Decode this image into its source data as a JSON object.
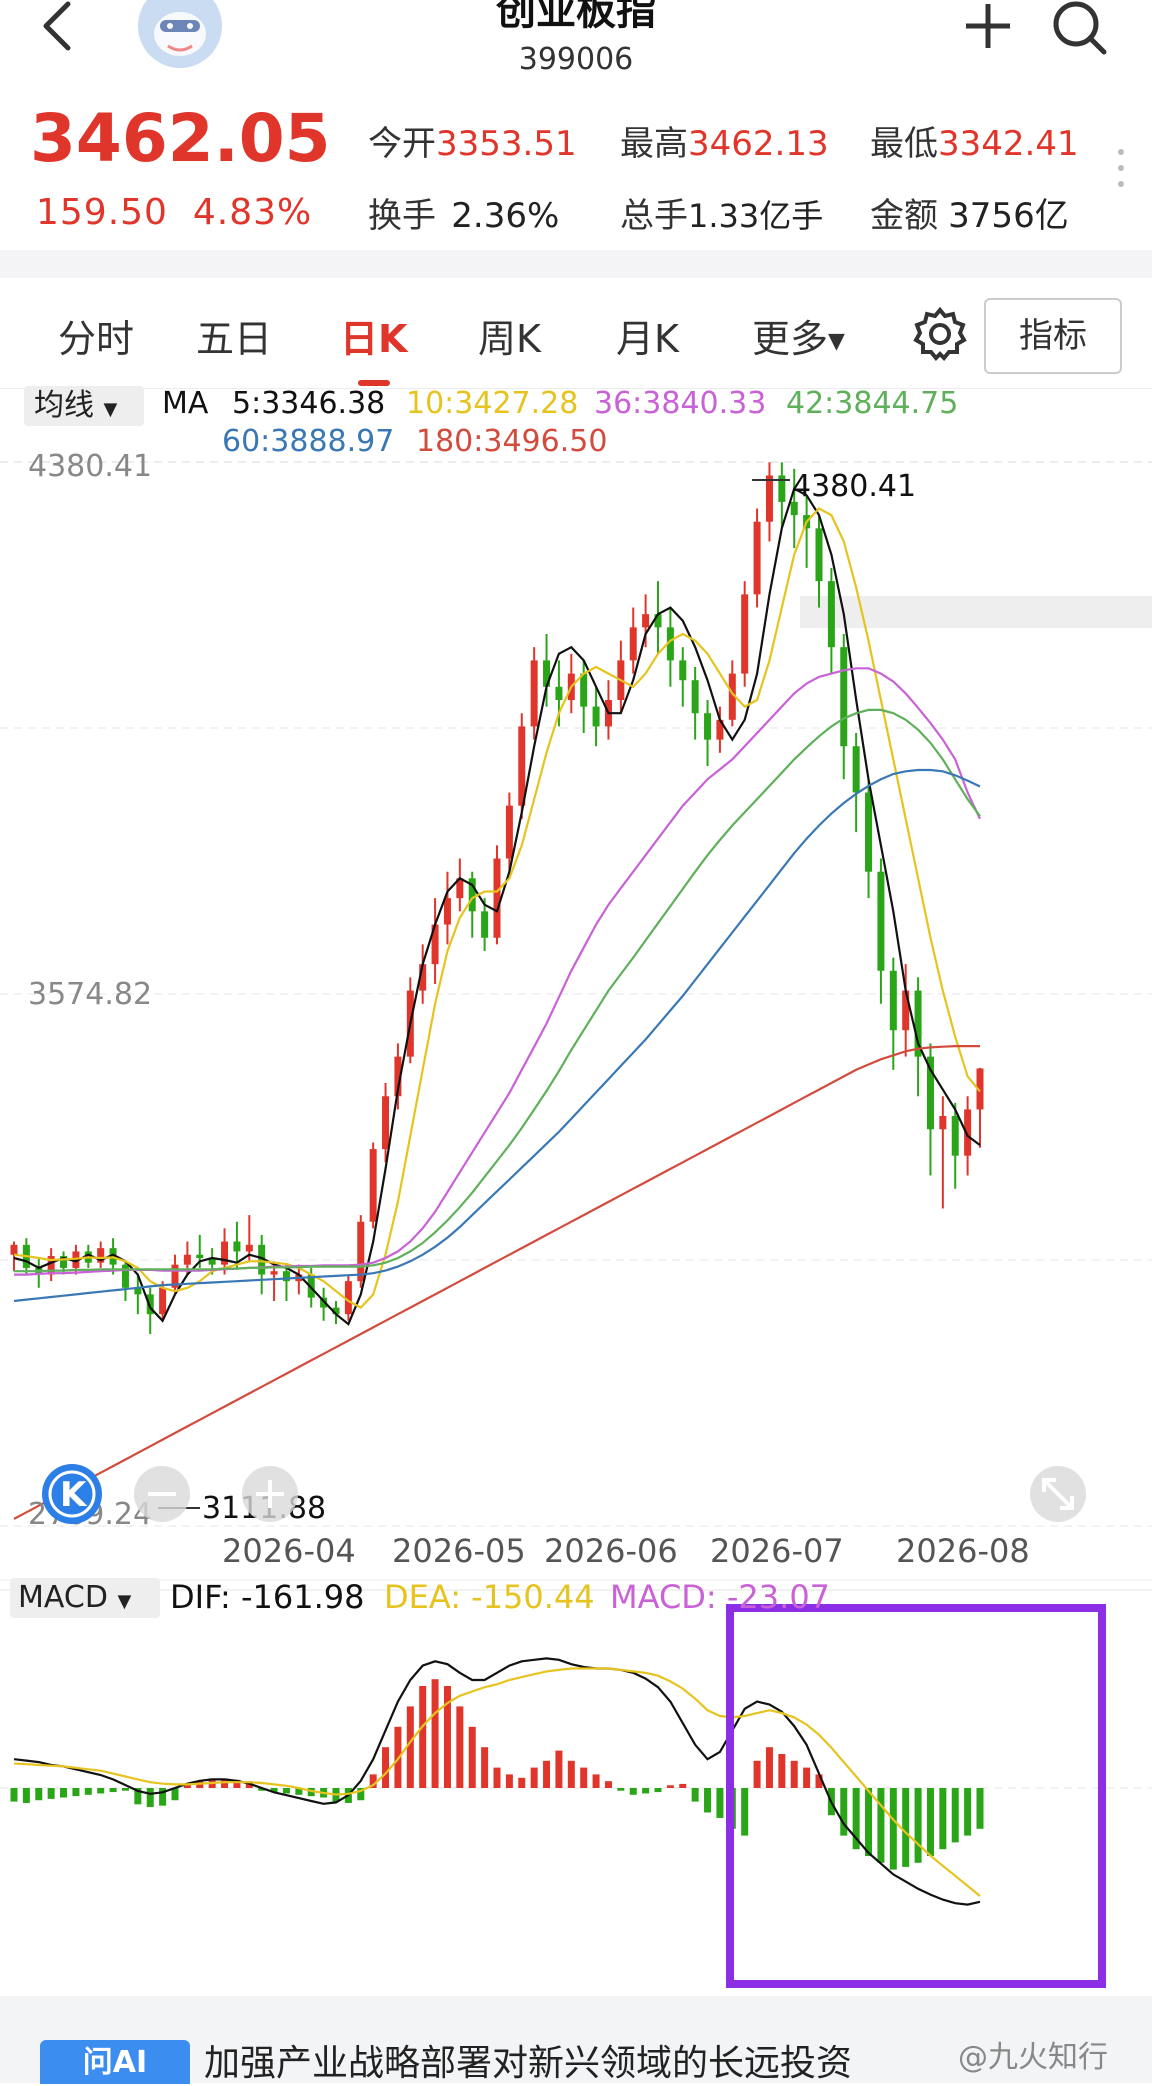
{
  "header": {
    "title": "创业板指",
    "code": "399006",
    "back_icon": "back-arrow-icon",
    "add_icon": "plus-icon",
    "search_icon": "search-icon"
  },
  "quote": {
    "price": "3462.05",
    "change": "159.50",
    "change_pct": "4.83%",
    "open_label": "今开",
    "open": "3353.51",
    "high_label": "最高",
    "high": "3462.13",
    "low_label": "最低",
    "low": "3342.41",
    "turnover_label": "换手",
    "turnover": "2.36%",
    "volume_label": "总手",
    "volume": "1.33亿手",
    "amount_label": "金额",
    "amount": "3756亿"
  },
  "tabs": [
    {
      "label": "分时"
    },
    {
      "label": "五日"
    },
    {
      "label": "日K",
      "active": true
    },
    {
      "label": "周K"
    },
    {
      "label": "月K"
    },
    {
      "label": "更多"
    }
  ],
  "indicator_button": "指标",
  "ma_legend": {
    "selector": "均线",
    "prefix": "MA",
    "items": [
      {
        "text": "5:3346.38",
        "color": "#111111"
      },
      {
        "text": "10:3427.28",
        "color": "#e6c31e"
      },
      {
        "text": "36:3840.33",
        "color": "#c862d6"
      },
      {
        "text": "42:3844.75",
        "color": "#5fb05a"
      },
      {
        "text": "60:3888.97",
        "color": "#3a78b5"
      },
      {
        "text": "180:3496.50",
        "color": "#d24b3c"
      }
    ]
  },
  "chart_labels": {
    "high_price": "4380.41",
    "mid_price": "3574.82",
    "low_price": "2769.24",
    "max_marker": "4380.41",
    "min_marker": "3111.88"
  },
  "chart_data": {
    "type": "candlestick",
    "ylim": [
      2769.24,
      4380.41
    ],
    "x_ticks": [
      "2026-04",
      "2026-05",
      "2026-06",
      "2026-07",
      "2026-08"
    ],
    "max_close_marker": 4380.41,
    "min_marker": 3111.88,
    "ma": {
      "MA5": [
        3175,
        3170,
        3160,
        3168,
        3175,
        3170,
        3180,
        3172,
        3180,
        3170,
        3150,
        3100,
        3080,
        3120,
        3150,
        3170,
        3175,
        3172,
        3168,
        3180,
        3175,
        3165,
        3160,
        3150,
        3130,
        3110,
        3090,
        3075,
        3120,
        3200,
        3310,
        3430,
        3530,
        3620,
        3680,
        3730,
        3750,
        3740,
        3710,
        3700,
        3760,
        3850,
        3950,
        4040,
        4090,
        4100,
        4080,
        4040,
        4000,
        4000,
        4050,
        4120,
        4150,
        4160,
        4140,
        4100,
        4050,
        3990,
        3960,
        3990,
        4060,
        4180,
        4280,
        4340,
        4330,
        4300,
        4240,
        4150,
        4020,
        3900,
        3800,
        3700,
        3580,
        3500,
        3460,
        3430,
        3400,
        3360,
        3346
      ],
      "MA10": [
        3180,
        3178,
        3175,
        3172,
        3173,
        3174,
        3176,
        3175,
        3176,
        3170,
        3160,
        3140,
        3130,
        3125,
        3130,
        3140,
        3155,
        3160,
        3165,
        3170,
        3170,
        3168,
        3166,
        3160,
        3150,
        3140,
        3125,
        3110,
        3100,
        3120,
        3180,
        3260,
        3360,
        3460,
        3560,
        3640,
        3690,
        3720,
        3730,
        3730,
        3750,
        3800,
        3870,
        3940,
        4000,
        4040,
        4060,
        4070,
        4060,
        4050,
        4040,
        4060,
        4090,
        4110,
        4120,
        4110,
        4090,
        4060,
        4030,
        4010,
        4020,
        4080,
        4160,
        4240,
        4290,
        4310,
        4300,
        4260,
        4190,
        4110,
        4020,
        3930,
        3840,
        3750,
        3660,
        3580,
        3510,
        3450,
        3427
      ],
      "MA36": [
        3150,
        3150,
        3151,
        3152,
        3152,
        3153,
        3154,
        3155,
        3156,
        3157,
        3157,
        3157,
        3156,
        3156,
        3156,
        3156,
        3157,
        3158,
        3159,
        3160,
        3161,
        3162,
        3162,
        3163,
        3163,
        3164,
        3164,
        3164,
        3165,
        3168,
        3175,
        3185,
        3200,
        3220,
        3245,
        3275,
        3305,
        3335,
        3365,
        3395,
        3425,
        3460,
        3495,
        3530,
        3570,
        3610,
        3645,
        3680,
        3710,
        3735,
        3760,
        3785,
        3810,
        3835,
        3860,
        3880,
        3900,
        3915,
        3930,
        3950,
        3970,
        3990,
        4010,
        4030,
        4045,
        4055,
        4060,
        4065,
        4068,
        4068,
        4060,
        4048,
        4030,
        4008,
        3985,
        3960,
        3930,
        3880,
        3840
      ],
      "MA42": [
        3155,
        3155,
        3155,
        3156,
        3156,
        3157,
        3157,
        3158,
        3158,
        3158,
        3158,
        3158,
        3158,
        3158,
        3158,
        3158,
        3158,
        3159,
        3159,
        3160,
        3160,
        3161,
        3161,
        3161,
        3162,
        3162,
        3162,
        3162,
        3162,
        3164,
        3168,
        3175,
        3185,
        3198,
        3214,
        3232,
        3252,
        3274,
        3298,
        3322,
        3346,
        3372,
        3400,
        3428,
        3458,
        3490,
        3520,
        3550,
        3580,
        3605,
        3630,
        3656,
        3682,
        3708,
        3734,
        3760,
        3785,
        3808,
        3830,
        3850,
        3870,
        3890,
        3910,
        3930,
        3948,
        3965,
        3980,
        3992,
        4000,
        4005,
        4005,
        4000,
        3990,
        3975,
        3955,
        3930,
        3900,
        3870,
        3844
      ],
      "MA60": [
        3110,
        3112,
        3114,
        3116,
        3118,
        3120,
        3122,
        3124,
        3126,
        3128,
        3130,
        3132,
        3134,
        3135,
        3136,
        3137,
        3138,
        3139,
        3140,
        3141,
        3142,
        3143,
        3144,
        3145,
        3146,
        3147,
        3148,
        3149,
        3150,
        3152,
        3156,
        3162,
        3170,
        3180,
        3192,
        3206,
        3222,
        3240,
        3258,
        3276,
        3294,
        3312,
        3330,
        3348,
        3366,
        3386,
        3406,
        3426,
        3446,
        3466,
        3486,
        3506,
        3528,
        3550,
        3572,
        3596,
        3620,
        3644,
        3668,
        3692,
        3716,
        3740,
        3764,
        3788,
        3810,
        3830,
        3848,
        3864,
        3878,
        3890,
        3900,
        3908,
        3912,
        3914,
        3914,
        3912,
        3906,
        3898,
        3889
      ],
      "MA180": [
        2780,
        2790,
        2800,
        2810,
        2820,
        2830,
        2840,
        2850,
        2860,
        2870,
        2880,
        2890,
        2900,
        2910,
        2920,
        2930,
        2940,
        2950,
        2960,
        2970,
        2980,
        2990,
        3000,
        3010,
        3020,
        3030,
        3040,
        3050,
        3060,
        3070,
        3080,
        3090,
        3100,
        3110,
        3120,
        3130,
        3140,
        3150,
        3160,
        3170,
        3180,
        3190,
        3200,
        3210,
        3220,
        3230,
        3240,
        3250,
        3260,
        3270,
        3280,
        3290,
        3300,
        3310,
        3320,
        3330,
        3340,
        3350,
        3360,
        3370,
        3380,
        3390,
        3400,
        3410,
        3420,
        3430,
        3440,
        3450,
        3460,
        3468,
        3476,
        3482,
        3488,
        3492,
        3494,
        3495,
        3496,
        3496,
        3496
      ]
    },
    "candles": [
      [
        3180,
        3195,
        3155,
        3200
      ],
      [
        3195,
        3160,
        3150,
        3205
      ],
      [
        3160,
        3150,
        3130,
        3175
      ],
      [
        3150,
        3178,
        3140,
        3190
      ],
      [
        3178,
        3160,
        3150,
        3185
      ],
      [
        3160,
        3185,
        3150,
        3195
      ],
      [
        3185,
        3168,
        3160,
        3195
      ],
      [
        3168,
        3190,
        3160,
        3200
      ],
      [
        3190,
        3165,
        3150,
        3205
      ],
      [
        3165,
        3130,
        3110,
        3170
      ],
      [
        3130,
        3120,
        3090,
        3150
      ],
      [
        3120,
        3090,
        3060,
        3130
      ],
      [
        3090,
        3130,
        3080,
        3140
      ],
      [
        3130,
        3165,
        3120,
        3180
      ],
      [
        3165,
        3180,
        3150,
        3200
      ],
      [
        3180,
        3175,
        3160,
        3210
      ],
      [
        3175,
        3165,
        3150,
        3190
      ],
      [
        3165,
        3200,
        3150,
        3220
      ],
      [
        3200,
        3185,
        3160,
        3230
      ],
      [
        3185,
        3195,
        3170,
        3240
      ],
      [
        3195,
        3150,
        3120,
        3210
      ],
      [
        3150,
        3155,
        3110,
        3170
      ],
      [
        3155,
        3140,
        3110,
        3165
      ],
      [
        3140,
        3150,
        3120,
        3165
      ],
      [
        3150,
        3115,
        3100,
        3160
      ],
      [
        3115,
        3100,
        3080,
        3130
      ],
      [
        3100,
        3090,
        3075,
        3110
      ],
      [
        3090,
        3140,
        3080,
        3150
      ],
      [
        3140,
        3230,
        3130,
        3240
      ],
      [
        3230,
        3340,
        3220,
        3350
      ],
      [
        3340,
        3420,
        3320,
        3440
      ],
      [
        3420,
        3480,
        3400,
        3500
      ],
      [
        3480,
        3580,
        3470,
        3600
      ],
      [
        3580,
        3620,
        3560,
        3650
      ],
      [
        3620,
        3680,
        3590,
        3720
      ],
      [
        3680,
        3720,
        3650,
        3760
      ],
      [
        3720,
        3750,
        3700,
        3780
      ],
      [
        3750,
        3700,
        3660,
        3760
      ],
      [
        3700,
        3660,
        3640,
        3720
      ],
      [
        3660,
        3780,
        3650,
        3800
      ],
      [
        3780,
        3860,
        3760,
        3880
      ],
      [
        3860,
        3980,
        3840,
        4000
      ],
      [
        3980,
        4080,
        3960,
        4100
      ],
      [
        4080,
        4040,
        4010,
        4120
      ],
      [
        4040,
        4020,
        3980,
        4080
      ],
      [
        4020,
        4060,
        4000,
        4090
      ],
      [
        4060,
        4010,
        3970,
        4080
      ],
      [
        4010,
        3980,
        3950,
        4040
      ],
      [
        3980,
        4020,
        3960,
        4050
      ],
      [
        4020,
        4080,
        4000,
        4110
      ],
      [
        4080,
        4130,
        4060,
        4160
      ],
      [
        4130,
        4150,
        4100,
        4180
      ],
      [
        4150,
        4130,
        4090,
        4200
      ],
      [
        4130,
        4080,
        4040,
        4160
      ],
      [
        4080,
        4050,
        4010,
        4100
      ],
      [
        4050,
        4000,
        3960,
        4070
      ],
      [
        4000,
        3960,
        3920,
        4020
      ],
      [
        3960,
        3990,
        3940,
        4010
      ],
      [
        3990,
        4060,
        3980,
        4080
      ],
      [
        4060,
        4180,
        4040,
        4200
      ],
      [
        4180,
        4290,
        4160,
        4310
      ],
      [
        4290,
        4360,
        4260,
        4380
      ],
      [
        4360,
        4320,
        4280,
        4380
      ],
      [
        4320,
        4300,
        4250,
        4370
      ],
      [
        4300,
        4280,
        4220,
        4330
      ],
      [
        4280,
        4200,
        4160,
        4300
      ],
      [
        4200,
        4100,
        4060,
        4220
      ],
      [
        4100,
        3950,
        3900,
        4120
      ],
      [
        3950,
        3880,
        3820,
        3970
      ],
      [
        3880,
        3760,
        3720,
        3900
      ],
      [
        3760,
        3610,
        3560,
        3780
      ],
      [
        3610,
        3520,
        3460,
        3630
      ],
      [
        3520,
        3580,
        3480,
        3620
      ],
      [
        3580,
        3480,
        3420,
        3600
      ],
      [
        3480,
        3370,
        3300,
        3500
      ],
      [
        3370,
        3390,
        3250,
        3420
      ],
      [
        3390,
        3330,
        3280,
        3410
      ],
      [
        3330,
        3400,
        3300,
        3420
      ],
      [
        3400,
        3462,
        3342,
        3463
      ]
    ]
  },
  "macd_legend": {
    "selector": "MACD",
    "dif": "DIF: -161.98",
    "dea": "DEA: -150.44",
    "macd": "MACD: -23.07"
  },
  "macd_data": {
    "hist": [
      -20,
      -22,
      -18,
      -16,
      -14,
      -12,
      -10,
      -8,
      -6,
      -4,
      -24,
      -28,
      -26,
      -18,
      6,
      10,
      14,
      14,
      12,
      10,
      -4,
      -6,
      -8,
      -10,
      -12,
      -14,
      -20,
      -22,
      -18,
      20,
      60,
      90,
      120,
      150,
      160,
      150,
      120,
      90,
      60,
      30,
      20,
      15,
      30,
      40,
      55,
      40,
      30,
      20,
      10,
      -4,
      -10,
      -8,
      -6,
      4,
      6,
      -20,
      -36,
      -44,
      -60,
      -70,
      40,
      60,
      50,
      40,
      30,
      20,
      -40,
      -70,
      -90,
      -100,
      -110,
      -120,
      -116,
      -110,
      -100,
      -90,
      -80,
      -70,
      -60
    ],
    "dif": [
      40,
      38,
      36,
      32,
      30,
      26,
      22,
      18,
      12,
      4,
      -4,
      -8,
      -6,
      0,
      6,
      10,
      12,
      12,
      10,
      6,
      0,
      -6,
      -10,
      -14,
      -18,
      -22,
      -20,
      -10,
      10,
      40,
      80,
      120,
      150,
      170,
      176,
      172,
      160,
      150,
      150,
      160,
      170,
      176,
      178,
      180,
      178,
      172,
      168,
      166,
      166,
      164,
      160,
      152,
      140,
      120,
      90,
      60,
      40,
      50,
      80,
      110,
      120,
      116,
      106,
      86,
      60,
      20,
      -20,
      -50,
      -70,
      -90,
      -105,
      -120,
      -130,
      -140,
      -148,
      -155,
      -160,
      -162,
      -158
    ],
    "dea": [
      34,
      33,
      32,
      31,
      30,
      28,
      26,
      24,
      20,
      16,
      12,
      8,
      6,
      5,
      5,
      6,
      7,
      8,
      8,
      8,
      7,
      5,
      3,
      0,
      -4,
      -7,
      -9,
      -8,
      -4,
      4,
      20,
      40,
      64,
      86,
      104,
      118,
      128,
      134,
      140,
      144,
      150,
      154,
      158,
      162,
      164,
      166,
      166,
      166,
      166,
      164,
      162,
      160,
      156,
      148,
      138,
      124,
      108,
      100,
      98,
      100,
      104,
      108,
      104,
      98,
      88,
      74,
      56,
      36,
      16,
      -4,
      -24,
      -44,
      -62,
      -78,
      -94,
      -108,
      -122,
      -136,
      -150
    ]
  },
  "news": {
    "badge": "问AI",
    "text": "加强产业战略部署对新兴领域的长远投资"
  },
  "watermark": "@九火知行",
  "colors": {
    "up": "#e0352b",
    "down": "#2aa518",
    "highlight_box": "#8b2ee6"
  }
}
